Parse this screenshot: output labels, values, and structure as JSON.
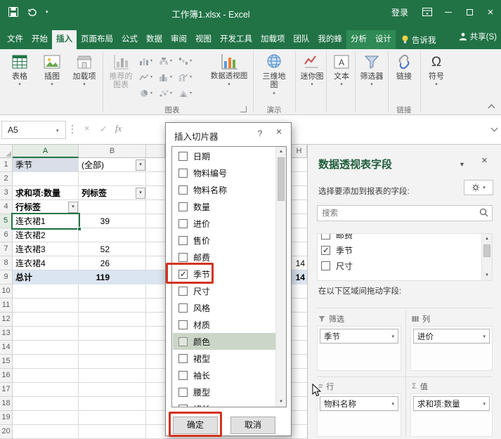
{
  "colors": {
    "excel_green": "#217346",
    "ribbon_bg": "#f1f1f1",
    "annotation_red": "#d2331f",
    "total_row_fill": "#dbe5f1",
    "filter_cell_fill": "#d9dee8"
  },
  "icons": {
    "dropdown": "▾",
    "up_arrow": "▲",
    "down_arrow": "▼",
    "close": "×",
    "help": "?",
    "check": "✓",
    "omega": "Ω",
    "sigma": "Σ",
    "rows": "≡"
  },
  "window": {
    "title": "工作簿1.xlsx - Excel",
    "sign_in": "登录"
  },
  "tabs": [
    {
      "label": "文件",
      "file": true
    },
    {
      "label": "开始"
    },
    {
      "label": "插入",
      "active": true
    },
    {
      "label": "页面布局"
    },
    {
      "label": "公式"
    },
    {
      "label": "数据"
    },
    {
      "label": "审阅"
    },
    {
      "label": "视图"
    },
    {
      "label": "开发工具"
    },
    {
      "label": "加载项"
    },
    {
      "label": "团队"
    },
    {
      "label": "我的蜂"
    },
    {
      "label": "分析",
      "contextual": true
    },
    {
      "label": "设计",
      "contextual": true
    }
  ],
  "tell_me": "告诉我",
  "share": "共享(S)",
  "ribbon": {
    "tables": "表格",
    "illustrations": "插图",
    "add_ins": "加载项",
    "recommended_charts": "推荐的图表",
    "pivot_chart": "数据透视图",
    "map_3d": "三维地图",
    "sparklines": "迷你图",
    "text": "文本",
    "filters": "筛选器",
    "link": "链接",
    "symbols": "符号",
    "group_charts": "图表",
    "group_tours": "演示",
    "group_links": "链接"
  },
  "formula_bar": {
    "name_box": "A5",
    "fx": "fx"
  },
  "sheet": {
    "columns": {
      "a": "A",
      "b": "B",
      "h": "H"
    },
    "row_numbers": [
      "1",
      "2",
      "3",
      "4",
      "5",
      "6",
      "7",
      "8",
      "9",
      "10",
      "11",
      "12",
      "13",
      "14",
      "15",
      "16",
      "17",
      "18",
      "19",
      "20"
    ],
    "cells": {
      "A1": "季节",
      "B1": "(全部)",
      "A3": "求和项:数量",
      "B3": "列标签",
      "A4": "行标签",
      "A5": "连衣裙1",
      "B5": "39",
      "A6": "连衣裙2",
      "A7": "连衣裙3",
      "B7": "52",
      "A8": "连衣裙4",
      "B8": "26",
      "H8": "14",
      "A9": "总计",
      "B9": "119",
      "H9": "14"
    },
    "selected_cell": "A5"
  },
  "dialog": {
    "title": "插入切片器",
    "fields": [
      {
        "label": "日期",
        "checked": false
      },
      {
        "label": "物料编号",
        "checked": false
      },
      {
        "label": "物料名称",
        "checked": false
      },
      {
        "label": "数量",
        "checked": false
      },
      {
        "label": "进价",
        "checked": false
      },
      {
        "label": "售价",
        "checked": false
      },
      {
        "label": "邮费",
        "checked": false
      },
      {
        "label": "季节",
        "checked": true
      },
      {
        "label": "尺寸",
        "checked": false
      },
      {
        "label": "风格",
        "checked": false
      },
      {
        "label": "材质",
        "checked": false
      },
      {
        "label": "颜色",
        "checked": false,
        "highlighted": true
      },
      {
        "label": "裙型",
        "checked": false
      },
      {
        "label": "袖长",
        "checked": false
      },
      {
        "label": "腰型",
        "checked": false
      },
      {
        "label": "裙长",
        "checked": false
      }
    ],
    "ok": "确定",
    "cancel": "取消"
  },
  "pane": {
    "title": "数据透视表字段",
    "subtitle": "选择要添加到报表的字段:",
    "search_placeholder": "搜索",
    "fields": [
      {
        "label": "邮费",
        "checked": false
      },
      {
        "label": "季节",
        "checked": true
      },
      {
        "label": "尺寸",
        "checked": false
      }
    ],
    "drag_hint": "在以下区域间拖动字段:",
    "areas": {
      "filters_label": "筛选",
      "filters_item": "季节",
      "columns_label": "列",
      "columns_item": "进价",
      "rows_label": "行",
      "rows_item": "物料名称",
      "values_label": "值",
      "values_item": "求和项:数量"
    }
  }
}
